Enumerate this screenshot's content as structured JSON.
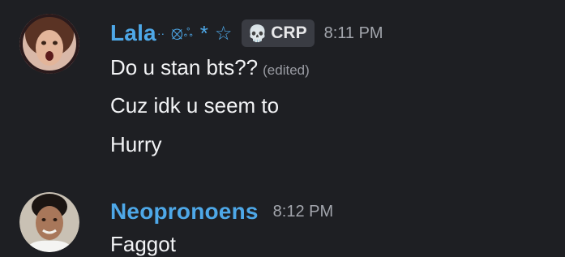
{
  "messages": [
    {
      "author": "Lala",
      "decorations": {
        "dots": "··",
        "symbol1": "⦻",
        "symbol2": "ஃ",
        "asterisk": "*",
        "star": "☆"
      },
      "tag": {
        "icon": "skull-icon",
        "glyph": "💀",
        "label": "CRP"
      },
      "timestamp": "8:11 PM",
      "lines": [
        "Do u stan bts??",
        "Cuz idk u seem to",
        "Hurry"
      ],
      "edited_label": "(edited)"
    },
    {
      "author": "Neopronoens",
      "timestamp": "8:12 PM",
      "lines": [
        "Faggot"
      ]
    }
  ],
  "colors": {
    "background": "#1e1f23",
    "username": "#4ea8e8",
    "text": "#f2f3f5",
    "timestamp": "#a3a6ad",
    "tag_bg": "#3a3c43"
  }
}
